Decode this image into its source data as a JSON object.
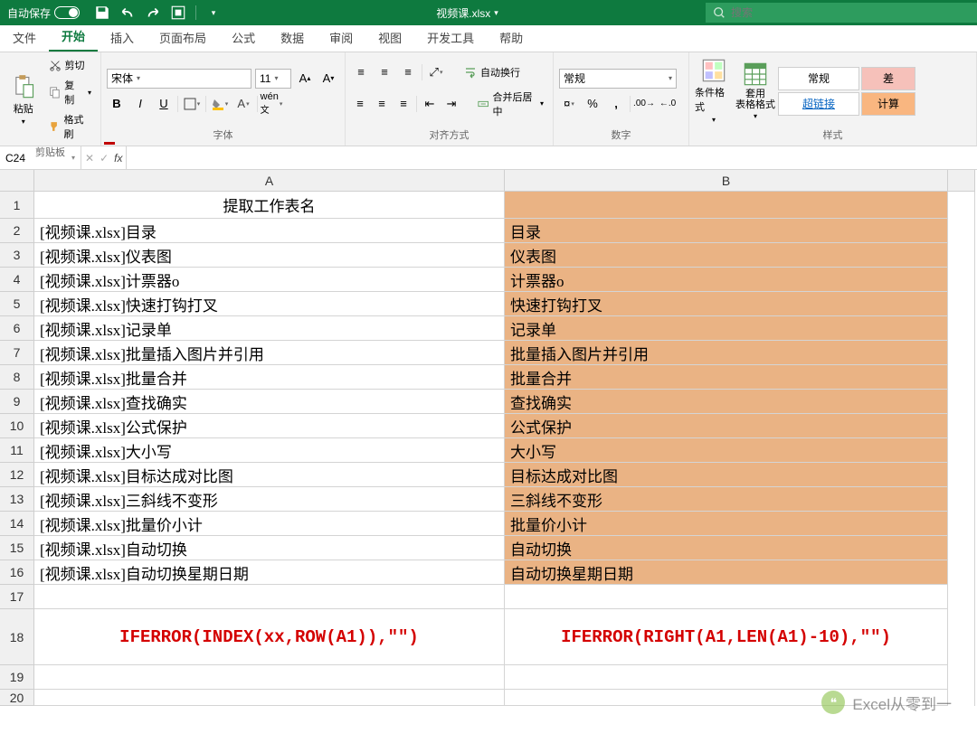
{
  "titlebar": {
    "autosave_label": "自动保存",
    "filename": "视频课.xlsx",
    "saved_indicator": "▾",
    "search_placeholder": "搜索"
  },
  "tabs": {
    "items": [
      "文件",
      "开始",
      "插入",
      "页面布局",
      "公式",
      "数据",
      "审阅",
      "视图",
      "开发工具",
      "帮助"
    ],
    "active_index": 1
  },
  "ribbon": {
    "clipboard": {
      "label": "剪贴板",
      "paste": "粘贴",
      "cut": "剪切",
      "copy": "复制",
      "painter": "格式刷"
    },
    "font": {
      "label": "字体",
      "name": "宋体",
      "size": "11"
    },
    "align": {
      "label": "对齐方式",
      "wrap": "自动换行",
      "merge": "合并后居中"
    },
    "number": {
      "label": "数字",
      "format": "常规"
    },
    "styles": {
      "label": "样式",
      "cond": "条件格式",
      "table": "套用\n表格格式",
      "normal": "常规",
      "bad": "差",
      "link": "超链接",
      "calc": "计算"
    }
  },
  "fbar": {
    "name": "C24",
    "formula": ""
  },
  "grid": {
    "col_labels": [
      "A",
      "B"
    ],
    "title": "提取工作表名",
    "rows": [
      {
        "a": "[视频课.xlsx]目录",
        "b": "目录"
      },
      {
        "a": "[视频课.xlsx]仪表图",
        "b": "仪表图"
      },
      {
        "a": "[视频课.xlsx]计票器o",
        "b": "计票器o"
      },
      {
        "a": "[视频课.xlsx]快速打钩打叉",
        "b": "快速打钩打叉"
      },
      {
        "a": "[视频课.xlsx]记录单",
        "b": "记录单"
      },
      {
        "a": "[视频课.xlsx]批量插入图片并引用",
        "b": "批量插入图片并引用"
      },
      {
        "a": "[视频课.xlsx]批量合并",
        "b": "批量合并"
      },
      {
        "a": "[视频课.xlsx]查找确实",
        "b": "查找确实"
      },
      {
        "a": "[视频课.xlsx]公式保护",
        "b": "公式保护"
      },
      {
        "a": "[视频课.xlsx]大小写",
        "b": "大小写"
      },
      {
        "a": "[视频课.xlsx]目标达成对比图",
        "b": "目标达成对比图"
      },
      {
        "a": "[视频课.xlsx]三斜线不变形",
        "b": "三斜线不变形"
      },
      {
        "a": "[视频课.xlsx]批量价小计",
        "b": "批量价小计"
      },
      {
        "a": "[视频课.xlsx]自动切换",
        "b": "自动切换"
      },
      {
        "a": "[视频课.xlsx]自动切换星期日期",
        "b": "自动切换星期日期"
      }
    ],
    "formula_a": "IFERROR(INDEX(xx,ROW(A1)),\"\")",
    "formula_b": "IFERROR(RIGHT(A1,LEN(A1)-10),\"\")"
  },
  "watermark": "Excel从零到一"
}
